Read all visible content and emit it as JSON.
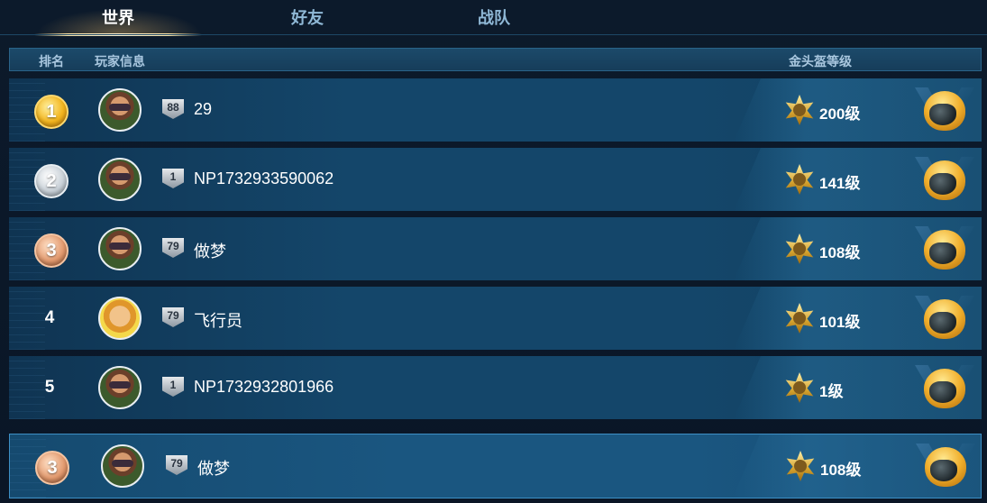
{
  "tabs": [
    {
      "label": "世界",
      "active": true
    },
    {
      "label": "好友",
      "active": false
    },
    {
      "label": "战队",
      "active": false
    }
  ],
  "header": {
    "rank": "排名",
    "player_info": "玩家信息",
    "helmet_level": "金头盔等级"
  },
  "rows": [
    {
      "rank": "1",
      "medal": "gold",
      "level": "88",
      "name": "29",
      "helmet_level": "200级",
      "avatar": "pilot-avatar"
    },
    {
      "rank": "2",
      "medal": "silver",
      "level": "1",
      "name": "NP1732933590062",
      "helmet_level": "141级",
      "avatar": "pilot-avatar"
    },
    {
      "rank": "3",
      "medal": "bronze",
      "level": "79",
      "name": "做梦",
      "helmet_level": "108级",
      "avatar": "pilot-avatar"
    },
    {
      "rank": "4",
      "medal": "",
      "level": "79",
      "name": "飞行员",
      "helmet_level": "101级",
      "avatar": "blonde-avatar"
    },
    {
      "rank": "5",
      "medal": "",
      "level": "1",
      "name": "NP1732932801966",
      "helmet_level": "1级",
      "avatar": "pilot-avatar"
    }
  ],
  "self_row": {
    "rank": "3",
    "medal": "bronze",
    "level": "79",
    "name": "做梦",
    "helmet_level": "108级",
    "avatar": "pilot-avatar"
  },
  "colors": {
    "accent": "#ffe7a8",
    "row": "#14466a",
    "self_border": "#3d8fc4"
  }
}
